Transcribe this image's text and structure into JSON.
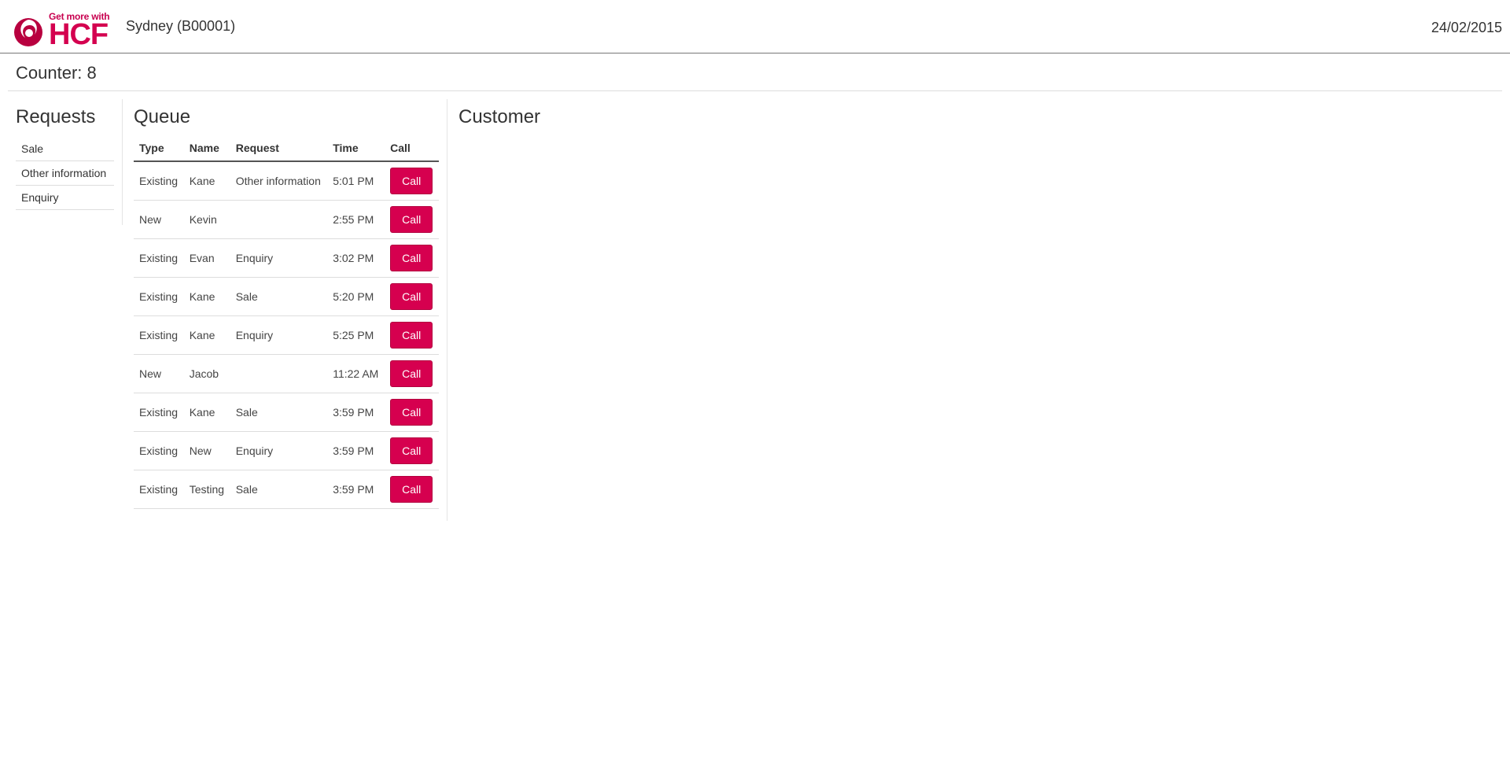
{
  "header": {
    "logo": {
      "tagline": "Get more with",
      "wordmark": "HCF",
      "color": "#d4004f"
    },
    "branch": "Sydney (B00001)",
    "date": "24/02/2015"
  },
  "counter": {
    "label": "Counter: 8"
  },
  "requests": {
    "title": "Requests",
    "items": [
      {
        "label": "Sale"
      },
      {
        "label": "Other information"
      },
      {
        "label": "Enquiry"
      }
    ]
  },
  "queue": {
    "title": "Queue",
    "columns": [
      "Type",
      "Name",
      "Request",
      "Time",
      "Call"
    ],
    "rows": [
      {
        "type": "Existing",
        "name": "Kane",
        "request": "Other information",
        "time": "5:01 PM",
        "action": "Call"
      },
      {
        "type": "New",
        "name": "Kevin",
        "request": "",
        "time": "2:55 PM",
        "action": "Call"
      },
      {
        "type": "Existing",
        "name": "Evan",
        "request": "Enquiry",
        "time": "3:02 PM",
        "action": "Call"
      },
      {
        "type": "Existing",
        "name": "Kane",
        "request": "Sale",
        "time": "5:20 PM",
        "action": "Call"
      },
      {
        "type": "Existing",
        "name": "Kane",
        "request": "Enquiry",
        "time": "5:25 PM",
        "action": "Call"
      },
      {
        "type": "New",
        "name": "Jacob",
        "request": "",
        "time": "11:22 AM",
        "action": "Call"
      },
      {
        "type": "Existing",
        "name": "Kane",
        "request": "Sale",
        "time": "3:59 PM",
        "action": "Call"
      },
      {
        "type": "Existing",
        "name": "New",
        "request": "Enquiry",
        "time": "3:59 PM",
        "action": "Call"
      },
      {
        "type": "Existing",
        "name": "Testing",
        "request": "Sale",
        "time": "3:59 PM",
        "action": "Call"
      }
    ]
  },
  "customer": {
    "title": "Customer"
  },
  "theme": {
    "accent": "#d6004f"
  }
}
